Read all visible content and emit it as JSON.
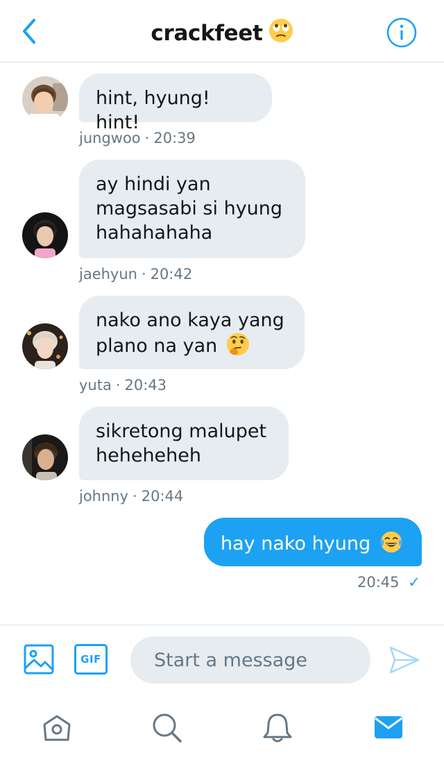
{
  "header": {
    "title": "crackfeet",
    "title_emoji": "eye-roll-emoji",
    "back_icon": "chevron-left-icon",
    "info_icon": "info-icon"
  },
  "messages": [
    {
      "sender": "jungwoo",
      "time": "20:39",
      "lines": [
        "hint, hyung! hint!"
      ],
      "direction": "incoming"
    },
    {
      "sender": "jaehyun",
      "time": "20:42",
      "lines": [
        "ay hindi yan",
        "magsasabi si hyung",
        "hahahahaha"
      ],
      "direction": "incoming"
    },
    {
      "sender": "yuta",
      "time": "20:43",
      "lines": [
        "nako ano kaya yang",
        "plano na yan"
      ],
      "trailing_emoji": "thinking-face-emoji",
      "direction": "incoming"
    },
    {
      "sender": "johnny",
      "time": "20:44",
      "lines": [
        "sikretong malupet",
        "heheheheh"
      ],
      "direction": "incoming"
    },
    {
      "sender": "",
      "time": "20:45",
      "lines": [
        "hay nako hyung"
      ],
      "trailing_emoji": "tears-of-joy-emoji",
      "direction": "outgoing",
      "status": "✓"
    }
  ],
  "meta_separator": "·",
  "composer": {
    "placeholder": "Start a message",
    "gif_label": "GIF",
    "image_icon": "image-icon",
    "send_icon": "send-icon"
  },
  "nav": {
    "items": [
      "home-icon",
      "search-icon",
      "notifications-icon",
      "messages-icon"
    ],
    "active": "messages-icon"
  },
  "colors": {
    "accent": "#1da1f2",
    "bubble_incoming": "#e6ecf0",
    "meta_text": "#657786",
    "nav_inactive": "#657786"
  }
}
